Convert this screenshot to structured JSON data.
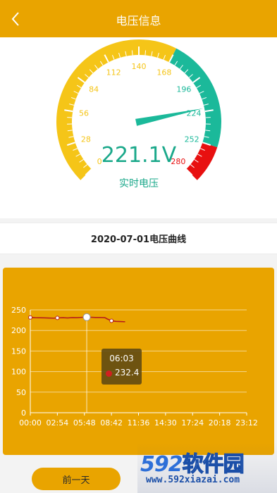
{
  "header": {
    "title": "电压信息"
  },
  "gauge": {
    "value_text": "221.1V",
    "value": 221.1,
    "label": "实时电压",
    "min": 0,
    "max": 280,
    "ticks": [
      "0",
      "28",
      "56",
      "84",
      "112",
      "140",
      "168",
      "196",
      "224",
      "252",
      "280"
    ],
    "colors": {
      "low": "#f5c518",
      "mid": "#1bb99a",
      "high": "#e81010",
      "value_text": "#1aa88a"
    }
  },
  "chart_title": "2020-07-01电压曲线",
  "tooltip": {
    "time": "06:03",
    "value": "232.4"
  },
  "prev_day_label": "前一天",
  "watermark": {
    "logo_num": "592",
    "logo_cn": "软件园",
    "url": "www.592xiazai.com"
  },
  "chart_data": {
    "type": "line",
    "title": "2020-07-01电压曲线",
    "xlabel": "",
    "ylabel": "",
    "x_ticks": [
      "00:00",
      "02:54",
      "05:48",
      "08:42",
      "11:36",
      "14:30",
      "17:24",
      "20:18",
      "23:12"
    ],
    "y_ticks": [
      0,
      50,
      100,
      150,
      200,
      250
    ],
    "xlim": [
      0,
      1392
    ],
    "ylim": [
      0,
      250
    ],
    "grid": true,
    "series": [
      {
        "color": "#b51c1c",
        "x": [
          "00:00",
          "00:30",
          "01:00",
          "01:30",
          "02:00",
          "02:30",
          "02:54",
          "03:30",
          "04:00",
          "04:30",
          "05:00",
          "05:30",
          "06:03",
          "06:30",
          "07:00",
          "07:30",
          "08:00",
          "08:15",
          "08:42",
          "09:10",
          "09:40",
          "10:10"
        ],
        "values": [
          231.5,
          231.0,
          230.8,
          230.6,
          230.2,
          229.9,
          230.5,
          231.0,
          230.5,
          231.2,
          231.0,
          231.8,
          232.4,
          232.0,
          231.5,
          231.6,
          231.0,
          228.0,
          223.5,
          222.0,
          221.6,
          221.1
        ]
      }
    ],
    "markers": [
      "00:00",
      "02:54",
      "06:03",
      "08:42"
    ],
    "highlight": "06:03"
  }
}
